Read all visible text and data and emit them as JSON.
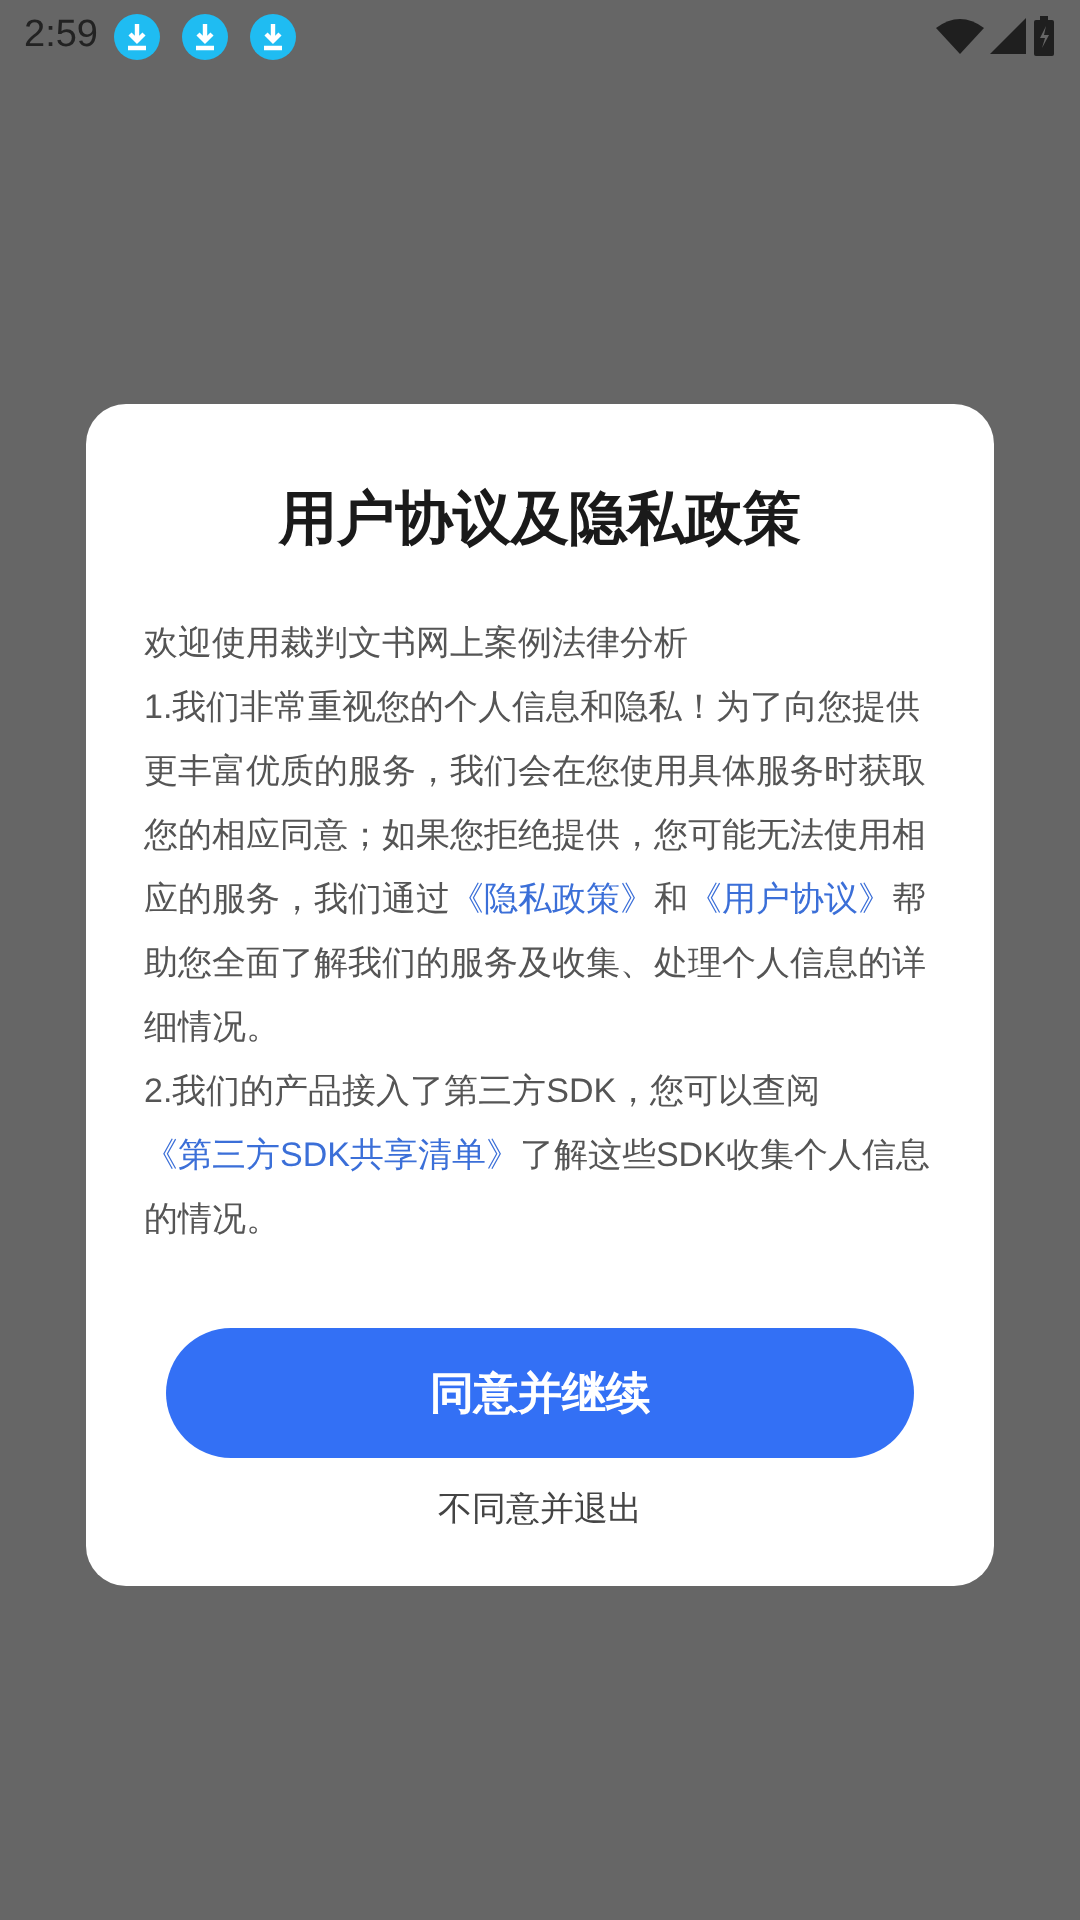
{
  "status_bar": {
    "time": "2:59",
    "notifications": [
      {
        "kind": "download"
      },
      {
        "kind": "download"
      },
      {
        "kind": "download"
      }
    ]
  },
  "dialog": {
    "title": "用户协议及隐私政策",
    "paragraphs": [
      [
        {
          "kind": "text",
          "text": "欢迎使用裁判文书网上案例法律分析"
        }
      ],
      [
        {
          "kind": "text",
          "text": "1.我们非常重视您的个人信息和隐私！为了向您提供更丰富优质的服务，我们会在您使用具体服务时获取您的相应同意；如果您拒绝提供，您可能无法使用相应的服务，我们通过"
        },
        {
          "kind": "link",
          "text": "《隐私政策》"
        },
        {
          "kind": "text",
          "text": "和"
        },
        {
          "kind": "link",
          "text": "《用户协议》"
        },
        {
          "kind": "text",
          "text": "帮助您全面了解我们的服务及收集、处理个人信息的详细情况。"
        }
      ],
      [
        {
          "kind": "text",
          "text": "2.我们的产品接入了第三方SDK，您可以查阅"
        },
        {
          "kind": "link",
          "text": "《第三方SDK共享清单》"
        },
        {
          "kind": "text",
          "text": "了解这些SDK收集个人信息的情况。"
        }
      ]
    ],
    "agree_button": "同意并继续",
    "decline_link": "不同意并退出"
  }
}
